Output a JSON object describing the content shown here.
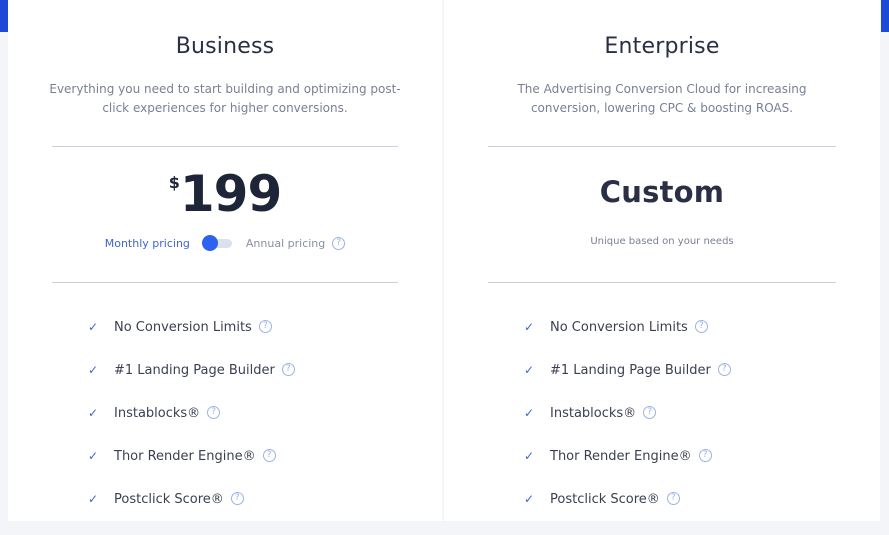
{
  "plans": [
    {
      "name": "Business",
      "description": "Everything you need to start building and optimizing post-click experiences for higher conversions.",
      "price": {
        "currency": "$",
        "amount": "199"
      },
      "billing": {
        "monthly_label": "Monthly pricing",
        "annual_label": "Annual pricing",
        "selected": "Monthly pricing"
      },
      "features": [
        "No Conversion Limits",
        "#1 Landing Page Builder",
        "Instablocks®",
        "Thor Render Engine®",
        "Postclick Score®"
      ]
    },
    {
      "name": "Enterprise",
      "description": "The Advertising Conversion Cloud for increasing conversion, lowering CPC & boosting ROAS.",
      "price_text": "Custom",
      "price_note": "Unique based on your needs",
      "features": [
        "No Conversion Limits",
        "#1 Landing Page Builder",
        "Instablocks®",
        "Thor Render Engine®",
        "Postclick Score®"
      ]
    }
  ],
  "icons": {
    "check": "check-icon",
    "help": "question-circle-icon"
  },
  "colors": {
    "accent": "#1c4ad6",
    "toggle": "#2d61f2",
    "text": "#2a2f45"
  }
}
